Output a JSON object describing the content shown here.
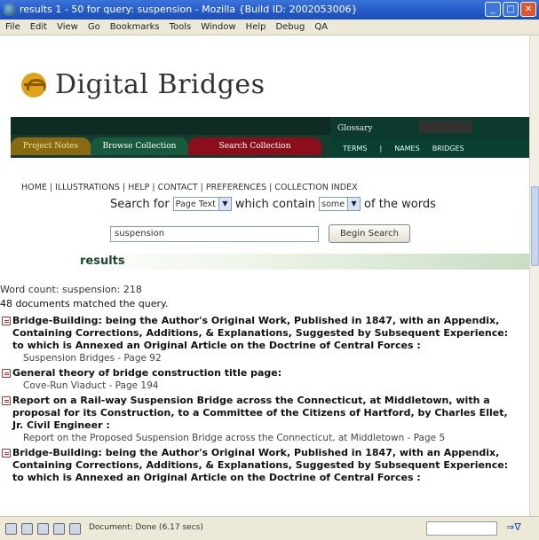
{
  "window": {
    "title": "results 1 - 50 for query: suspension - Mozilla {Build ID: 2002053006}",
    "controls": [
      "_",
      "□",
      "✕"
    ]
  },
  "menu": [
    "File",
    "Edit",
    "View",
    "Go",
    "Bookmarks",
    "Tools",
    "Window",
    "Help",
    "Debug",
    "QA"
  ],
  "site": {
    "logo_text": "Digital Bridges"
  },
  "nav": {
    "tabs": [
      "Project Notes",
      "Browse Collection",
      "Search Collection"
    ],
    "glossary_title": "Glossary",
    "glossary_links": [
      "TERMS",
      "|",
      "NAMES",
      "BRIDGES"
    ]
  },
  "links": "HOME | ILLUSTRATIONS | HELP | CONTACT | PREFERENCES | COLLECTION INDEX",
  "search": {
    "prefix": "Search for",
    "field": "Page Text",
    "middle": "which contain",
    "mode": "some",
    "suffix": "of the words",
    "query": "suspension",
    "button": "Begin Search"
  },
  "results_header": "results",
  "word_count": "Word count: suspension: 218",
  "matches": "48 documents matched the query.",
  "results": [
    {
      "title": "Bridge-Building: being the Author's Original Work, Published in 1847, with an Appendix, Containing Corrections, Additions, & Explanations, Suggested by Subsequent Experience: to which is Annexed an Original Article on the Doctrine of Central Forces :",
      "sub": "Suspension Bridges - Page 92"
    },
    {
      "title": "General theory of bridge construction title page:",
      "sub": "Cove-Run Viaduct - Page 194"
    },
    {
      "title": "Report on a Rail-way Suspension Bridge across the Connecticut, at Middletown, with a proposal for its Construction, to a Committee of the Citizens of Hartford, by Charles Ellet, Jr. Civil Engineer :",
      "sub": "Report on the Proposed Suspension Bridge across the Connecticut, at Middletown - Page 5"
    },
    {
      "title": "Bridge-Building: being the Author's Original Work, Published in 1847, with an Appendix, Containing Corrections, Additions, & Explanations, Suggested by Subsequent Experience: to which is Annexed an Original Article on the Doctrine of Central Forces :",
      "sub": ""
    }
  ],
  "status": {
    "text": "Document: Done (6.17 secs)"
  }
}
